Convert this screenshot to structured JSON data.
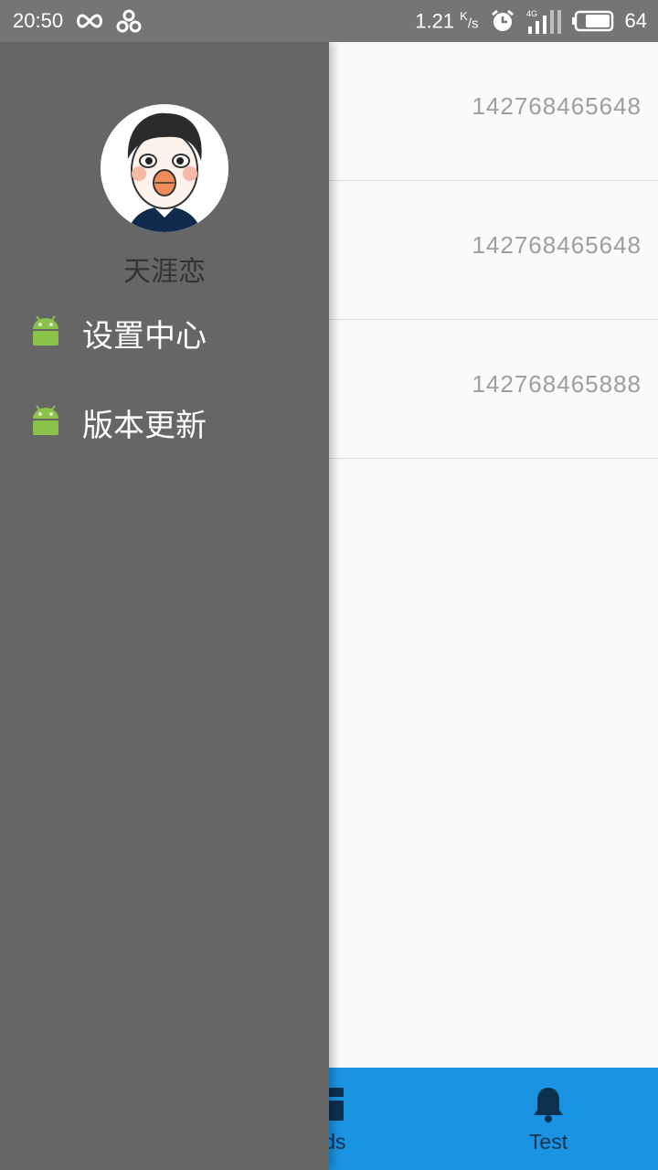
{
  "status_bar": {
    "time": "20:50",
    "network_speed": "1.21",
    "network_unit_top": "K",
    "network_unit_bottom": "/s",
    "battery": "64",
    "icons": [
      "infinity-icon",
      "link-icon",
      "alarm-icon",
      "signal-4g-icon",
      "battery-icon"
    ]
  },
  "list": {
    "rows": [
      {
        "number": "142768465648"
      },
      {
        "number": "142768465648"
      },
      {
        "number": "142768465888"
      }
    ]
  },
  "bottom_nav": {
    "items": [
      {
        "label": "nds",
        "icon": "list-icon"
      },
      {
        "label": "Test",
        "icon": "bell-icon"
      }
    ],
    "color": "#1a94e2"
  },
  "drawer": {
    "user_name": "天涯恋",
    "menu": [
      {
        "label": "设置中心",
        "icon": "android-icon"
      },
      {
        "label": "版本更新",
        "icon": "android-icon"
      }
    ],
    "background": "#666666"
  }
}
